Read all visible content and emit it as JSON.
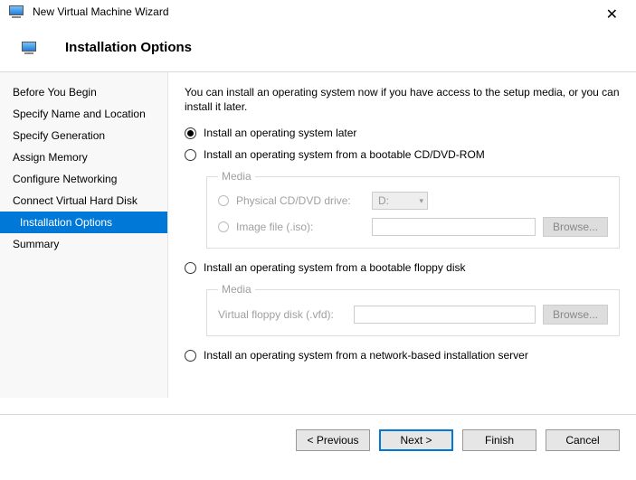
{
  "window": {
    "title": "New Virtual Machine Wizard"
  },
  "header": {
    "heading": "Installation Options"
  },
  "sidebar": {
    "items": [
      {
        "label": "Before You Begin"
      },
      {
        "label": "Specify Name and Location"
      },
      {
        "label": "Specify Generation"
      },
      {
        "label": "Assign Memory"
      },
      {
        "label": "Configure Networking"
      },
      {
        "label": "Connect Virtual Hard Disk"
      },
      {
        "label": "Installation Options"
      },
      {
        "label": "Summary"
      }
    ]
  },
  "content": {
    "intro": "You can install an operating system now if you have access to the setup media, or you can install it later.",
    "option_later": "Install an operating system later",
    "option_cd": "Install an operating system from a bootable CD/DVD-ROM",
    "option_floppy": "Install an operating system from a bootable floppy disk",
    "option_network": "Install an operating system from a network-based installation server",
    "media_legend": "Media",
    "cd_physical_label": "Physical CD/DVD drive:",
    "cd_physical_value": "D:",
    "cd_image_label": "Image file (.iso):",
    "floppy_label": "Virtual floppy disk (.vfd):",
    "browse_label": "Browse..."
  },
  "footer": {
    "previous": "< Previous",
    "next": "Next >",
    "finish": "Finish",
    "cancel": "Cancel"
  }
}
